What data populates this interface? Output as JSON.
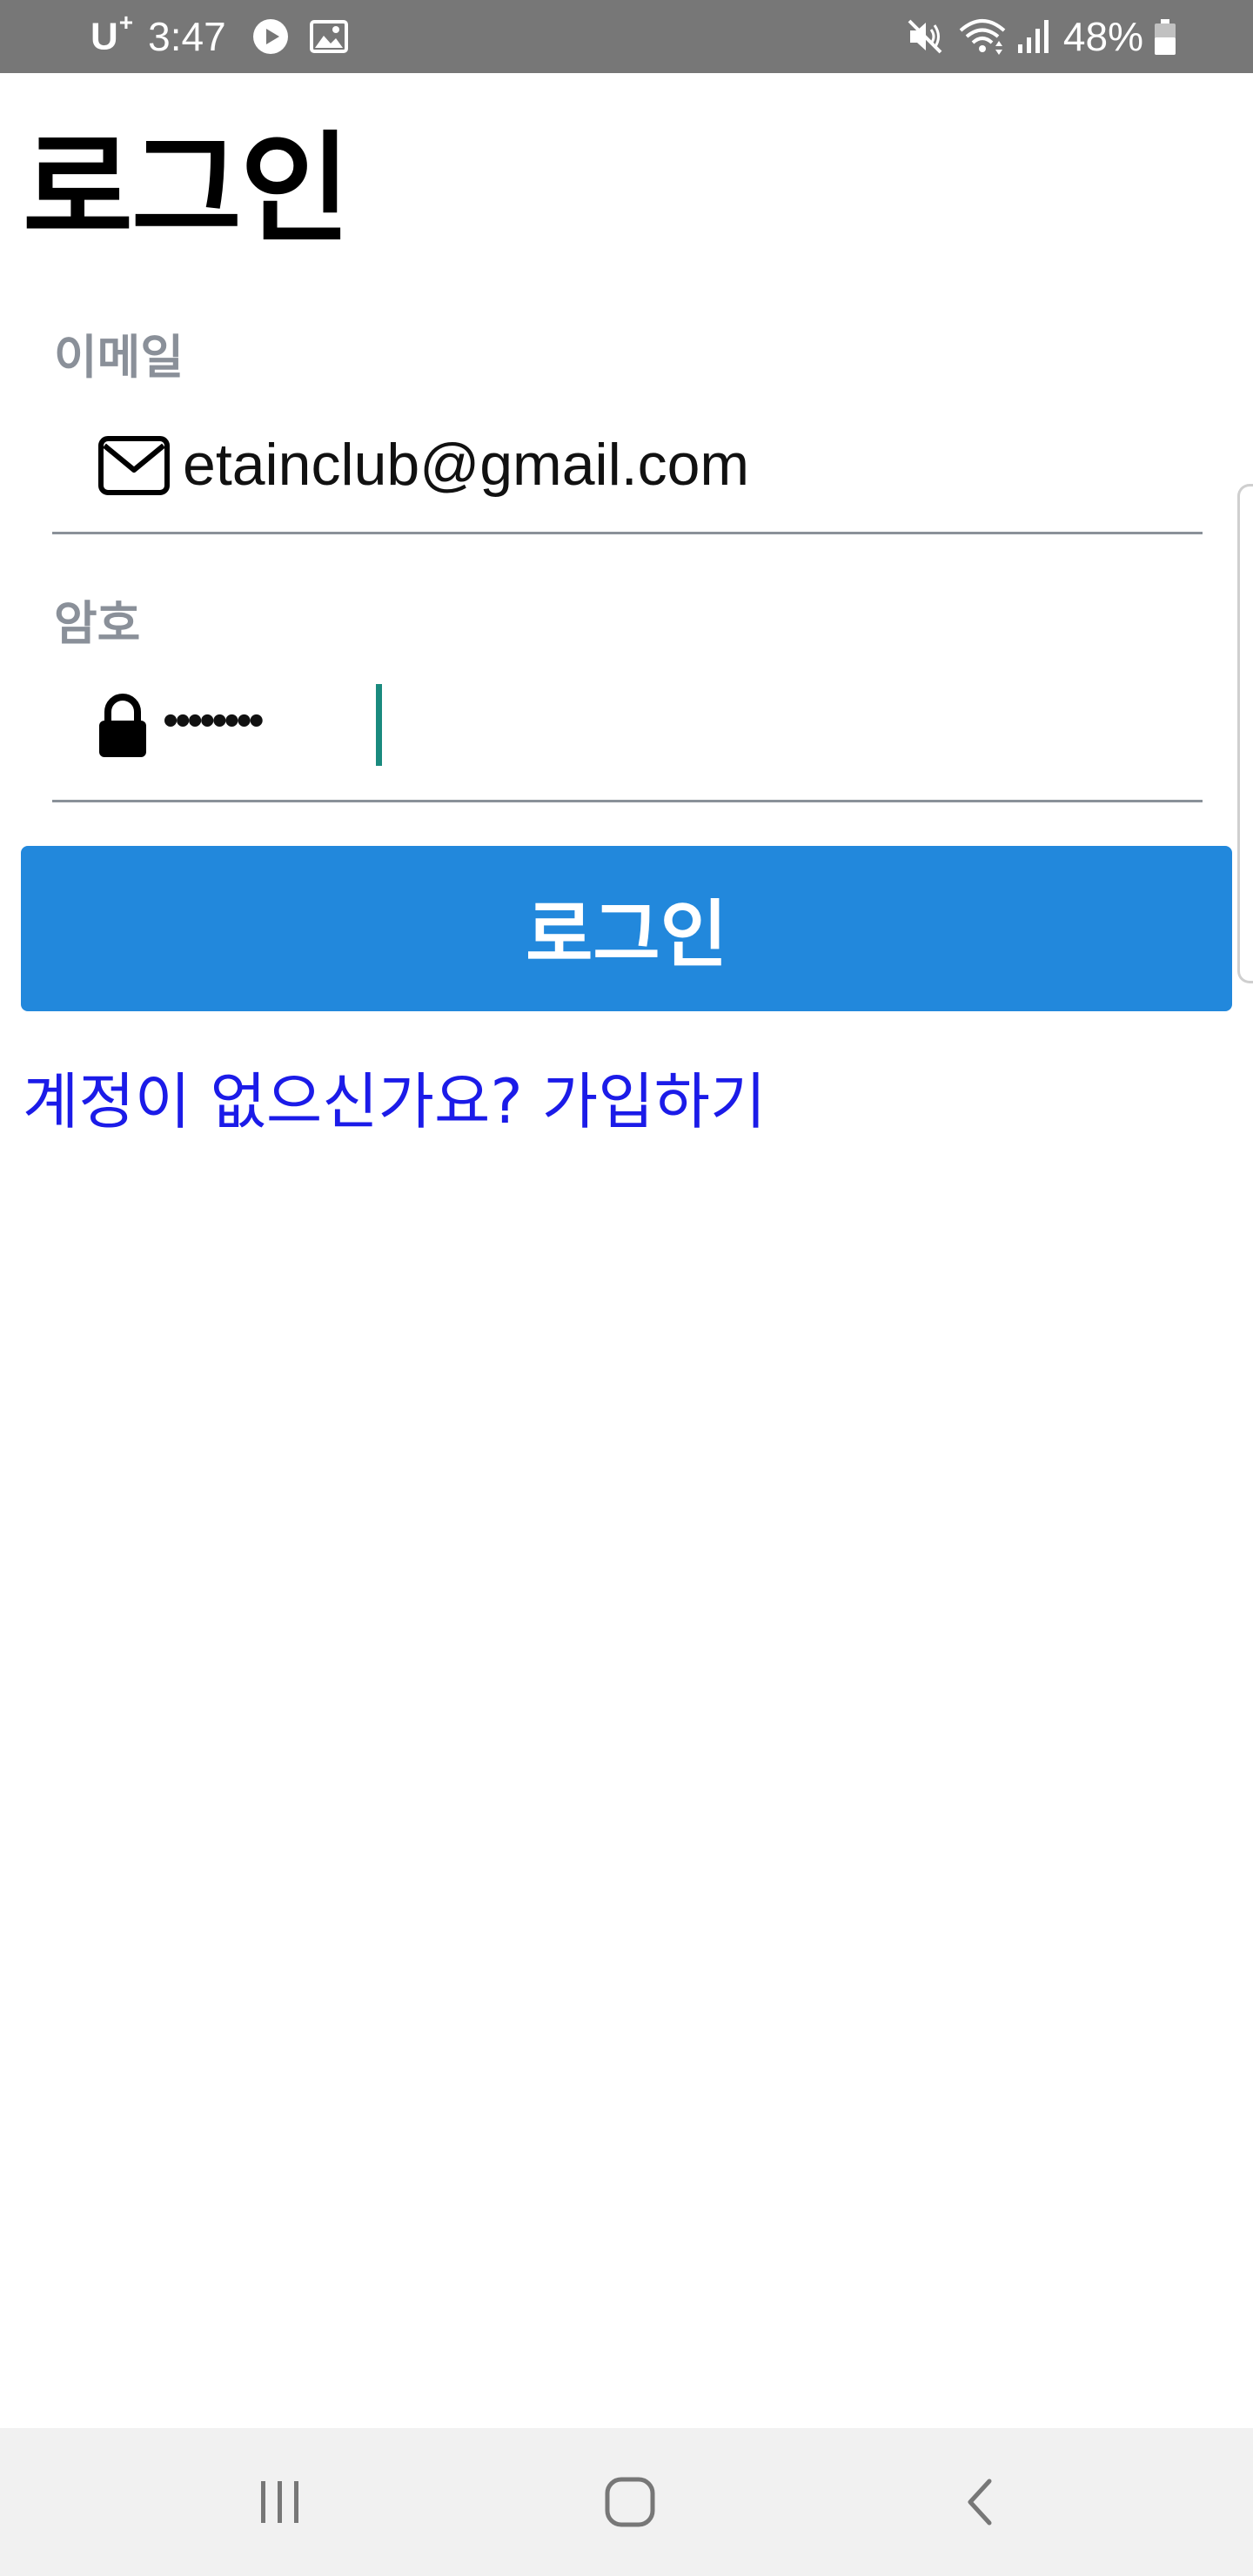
{
  "status_bar": {
    "carrier": "U",
    "carrier_plus": "+",
    "time": "3:47",
    "battery_percent": "48%",
    "icons": [
      "play-icon",
      "gallery-icon",
      "mute-icon",
      "wifi-icon",
      "signal-icon",
      "battery-icon"
    ]
  },
  "page": {
    "title": "로그인"
  },
  "form": {
    "email": {
      "label": "이메일",
      "value": "etainclub@gmail.com",
      "icon": "mail-icon"
    },
    "password": {
      "label": "암호",
      "masked_value": "••••••••",
      "icon": "lock-icon"
    },
    "login_button_label": "로그인"
  },
  "signup_link": "계정이 없으신가요? 가입하기",
  "nav_bar": {
    "icons": [
      "recents-icon",
      "home-icon",
      "back-icon"
    ]
  },
  "colors": {
    "status_bar": "#777777",
    "primary_button": "#2288dc",
    "link": "#1b1be8",
    "label": "#8a9099",
    "caret": "#1a8a7e",
    "nav_bar": "#f1f1f1"
  }
}
